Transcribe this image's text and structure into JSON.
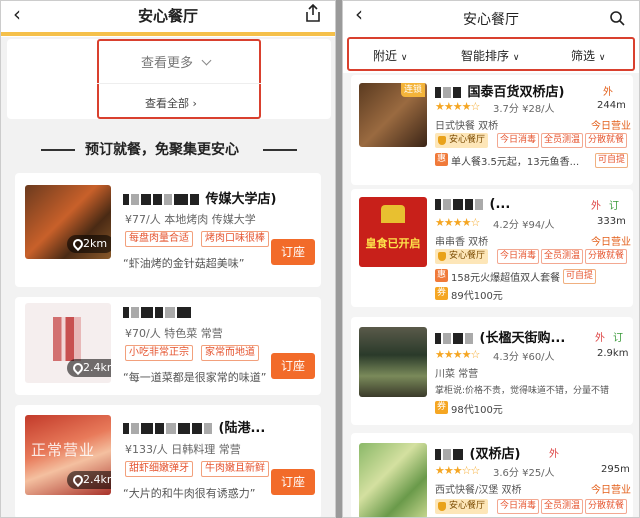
{
  "left": {
    "title": "安心餐厅",
    "more_label": "查看更多",
    "all_label": "查看全部",
    "promo": "预订就餐，免聚集更安心",
    "items": [
      {
        "name_suffix": "传媒大学店)",
        "meta": "¥77/人  本地烤肉  传媒大学",
        "tags": [
          "每盘肉量合适",
          "烤肉口味很棒"
        ],
        "quote": "“虾油烤的金针菇超美味”",
        "distance": "2km",
        "button": "订座"
      },
      {
        "name_suffix": "",
        "meta": "¥70/人  特色菜  常营",
        "tags": [
          "小吃非常正宗",
          "家常而地道"
        ],
        "quote": "“每一道菜都是很家常的味道”",
        "distance": "2.4km",
        "button": "订座"
      },
      {
        "name_suffix": "(陆港...",
        "meta": "¥133/人  日韩料理  常营",
        "tags": [
          "甜虾细嫩弹牙",
          "牛肉嫩且新鲜"
        ],
        "quote": "“大片的和牛肉很有诱惑力”",
        "distance": "2.4km",
        "button": "订座",
        "overlay": "正常营业"
      }
    ]
  },
  "right": {
    "title": "安心餐厅",
    "filters": [
      "附近",
      "智能排序",
      "筛选"
    ],
    "badge": "安心餐厅",
    "items": [
      {
        "name": "国泰百货双桥店)",
        "tag": "外",
        "rating": "3.7分",
        "price": "¥28/人",
        "distance": "244m",
        "sub": "日式快餐  双桥",
        "chips": [
          "今日消毒",
          "全员测温",
          "分散就餐"
        ],
        "status": "今日营业",
        "offer": "单人餐3.5元起，13元鱼香...",
        "offer_tag": "可自提",
        "ribbon": "连锁"
      },
      {
        "name": "(...",
        "tag": "外",
        "tag2": "订",
        "rating": "4.2分",
        "price": "¥94/人",
        "distance": "333m",
        "sub": "串串香  双桥",
        "chips": [
          "今日消毒",
          "全员测温",
          "分散就餐"
        ],
        "status": "今日营业",
        "offer": "158元火爆超值双人套餐",
        "offer_tag": "可自提",
        "offer2": "89代100元",
        "thumb_text": "皇食已开启"
      },
      {
        "name": "(长楹天街购...",
        "tag": "外",
        "tag2": "订",
        "rating": "4.3分",
        "price": "¥60/人",
        "distance": "2.9km",
        "sub": "川菜  常营",
        "comment": "掌柜说:价格不贵，觉得味道不错，分量不错",
        "offer2": "98代100元"
      },
      {
        "name": "(双桥店)",
        "tag": "外",
        "rating": "3.6分",
        "price": "¥25/人",
        "distance": "295m",
        "sub": "西式快餐/汉堡  双桥",
        "status": "今日营业",
        "chips": [
          "今日消毒",
          "全员测温",
          "分散就餐"
        ]
      }
    ]
  },
  "colors": {
    "accent": "#f26b2a",
    "highlight": "#d9402e",
    "star": "#f5a623"
  }
}
